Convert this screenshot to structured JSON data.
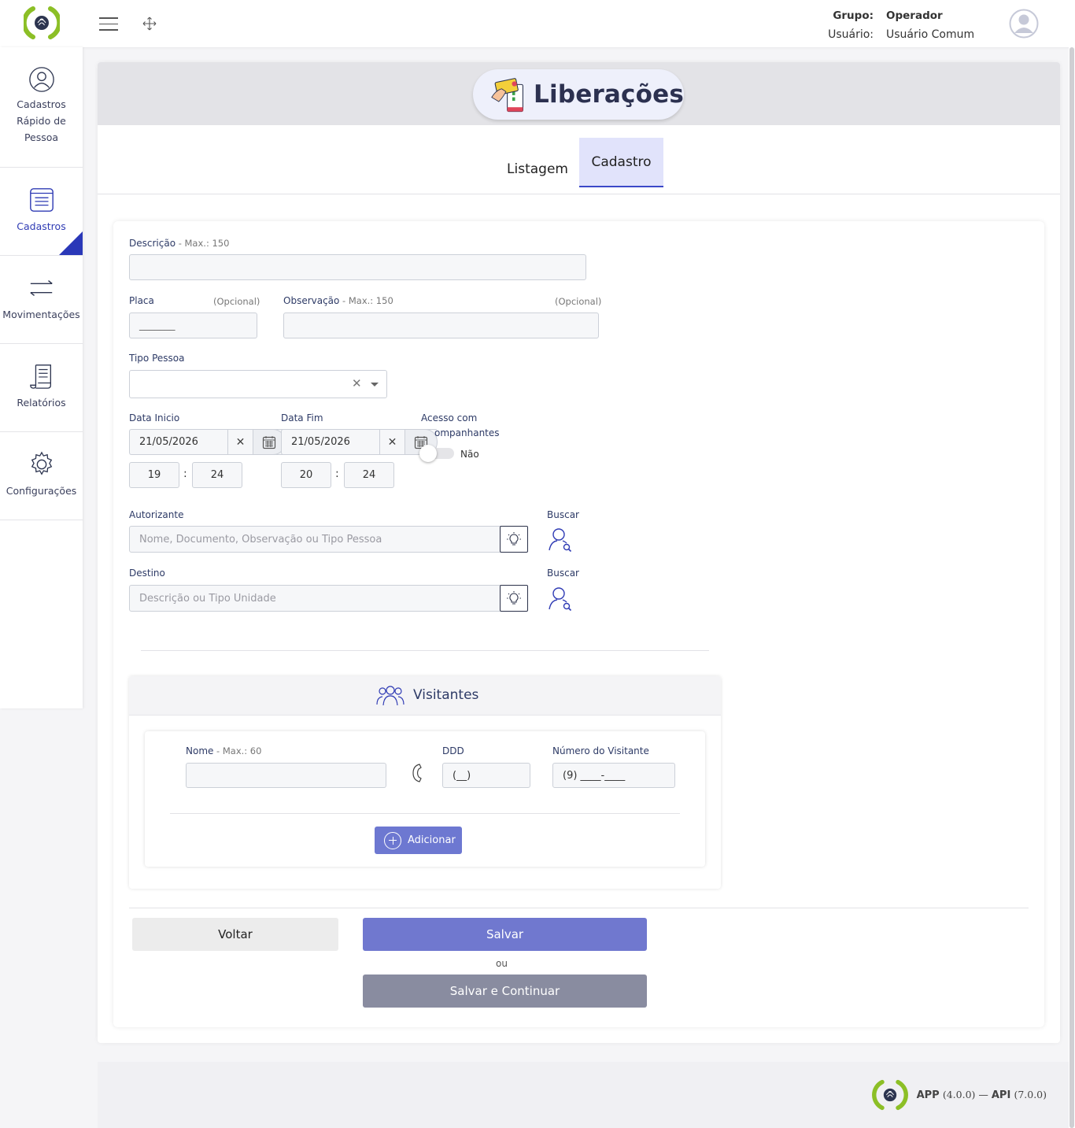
{
  "header": {
    "grupo_label": "Grupo:",
    "grupo_value": "Operador",
    "usuario_label": "Usuário:",
    "usuario_value": "Usuário Comum"
  },
  "sidebar": {
    "items": [
      {
        "label_lines": [
          "Cadastros",
          "Rápido de",
          "Pessoa"
        ],
        "icon": "person-circle-icon",
        "active": false
      },
      {
        "label": "Cadastros",
        "icon": "register-list-icon",
        "active": true
      },
      {
        "label": "Movimentações",
        "icon": "arrows-exchange-icon",
        "active": false
      },
      {
        "label": "Relatórios",
        "icon": "report-scroll-icon",
        "active": false
      },
      {
        "label": "Configurações",
        "icon": "gear-icon",
        "active": false
      }
    ]
  },
  "page": {
    "title": "Liberações",
    "tabs": [
      "Listagem",
      "Cadastro"
    ],
    "active_tab": "Cadastro"
  },
  "form": {
    "descricao": {
      "label": "Descrição",
      "hint": " - Max.: 150",
      "value": ""
    },
    "placa": {
      "label": "Placa",
      "optional": "(Opcional)",
      "value": "_______"
    },
    "observacao": {
      "label": "Observação",
      "hint": " - Max.: 150",
      "optional": "(Opcional)",
      "value": ""
    },
    "tipo_pessoa": {
      "label": "Tipo Pessoa",
      "value": ""
    },
    "data_inicio": {
      "label": "Data Inicio",
      "date": "21/05/2026",
      "hour": "19",
      "minute": "24"
    },
    "data_fim": {
      "label": "Data Fim",
      "date": "21/05/2026",
      "hour": "20",
      "minute": "24"
    },
    "acesso": {
      "label_line1": "Acesso com",
      "label_line2": "ompanhantes",
      "value_label": "Não",
      "value": false
    },
    "autorizante": {
      "label": "Autorizante",
      "placeholder": "Nome, Documento, Observação ou Tipo Pessoa",
      "search_label": "Buscar"
    },
    "destino": {
      "label": "Destino",
      "placeholder": "Descrição ou Tipo Unidade",
      "search_label": "Buscar"
    },
    "separator_colon": ":"
  },
  "visitantes": {
    "title": "Visitantes",
    "nome": {
      "label": "Nome",
      "hint": " - Max.: 60",
      "value": ""
    },
    "ddd": {
      "label": "DDD",
      "value": "(__)"
    },
    "numero": {
      "label": "Número do Visitante",
      "value": "(9) ____-____"
    },
    "add_label": "Adicionar"
  },
  "actions": {
    "voltar": "Voltar",
    "salvar": "Salvar",
    "ou": "ou",
    "salvar_continuar": "Salvar e Continuar"
  },
  "footer": {
    "app_label": "APP",
    "app_version": "(4.0.0)",
    "sep": " — ",
    "api_label": "API",
    "api_version": "(7.0.0)"
  },
  "colors": {
    "brand_green": "#8cbf26",
    "accent_blue": "#2f3bb4",
    "save_button": "#7078cf",
    "continue_button": "#898ca0"
  }
}
